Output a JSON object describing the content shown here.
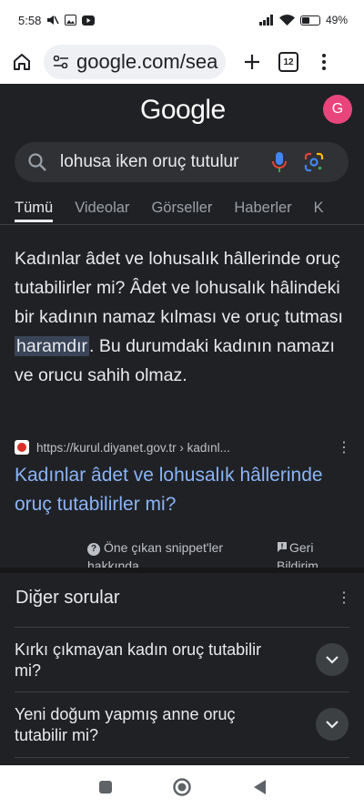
{
  "status_bar": {
    "time": "5:58",
    "battery": "49%",
    "battery_level": 0.49,
    "icons": [
      "mute-icon",
      "gallery-icon",
      "youtube-icon",
      "signal-icon",
      "wifi-icon",
      "battery-icon"
    ]
  },
  "browser": {
    "url": "google.com/sea",
    "tab_count": "12"
  },
  "google": {
    "logo": "Google",
    "avatar_letter": "G",
    "avatar_color": "#e8457c",
    "search_query": "lohusa iken oruç tutulur",
    "tabs": [
      "Tümü",
      "Videolar",
      "Görseller",
      "Haberler",
      "K"
    ]
  },
  "snippet": {
    "text_before": "Kadınlar âdet ve lohusalık hâllerinde oruç tutabilirler mi? Âdet ve lohusalık hâlindeki bir kadının namaz kılması ve oruç tutması ",
    "highlight": "haramdır",
    "text_after": ". Bu durumdaki kadının namazı ve orucu sahih olmaz.",
    "source_url": "https://kurul.diyanet.gov.tr › kadınl...",
    "result_title": "Kadınlar âdet ve lohusalık hâllerinde oruç tutabilirler mi?",
    "about_label": "Öne çıkan snippet'ler hakkında",
    "feedback_label": "Geri Bildirim"
  },
  "paa": {
    "title": "Diğer sorular",
    "questions": [
      "Kırkı çıkmayan kadın oruç tutabilir mi?",
      "Yeni doğum yapmış anne oruç tutabilir mi?"
    ]
  },
  "colors": {
    "background": "#202124",
    "link": "#8ab4f8",
    "highlight": "#394457"
  }
}
